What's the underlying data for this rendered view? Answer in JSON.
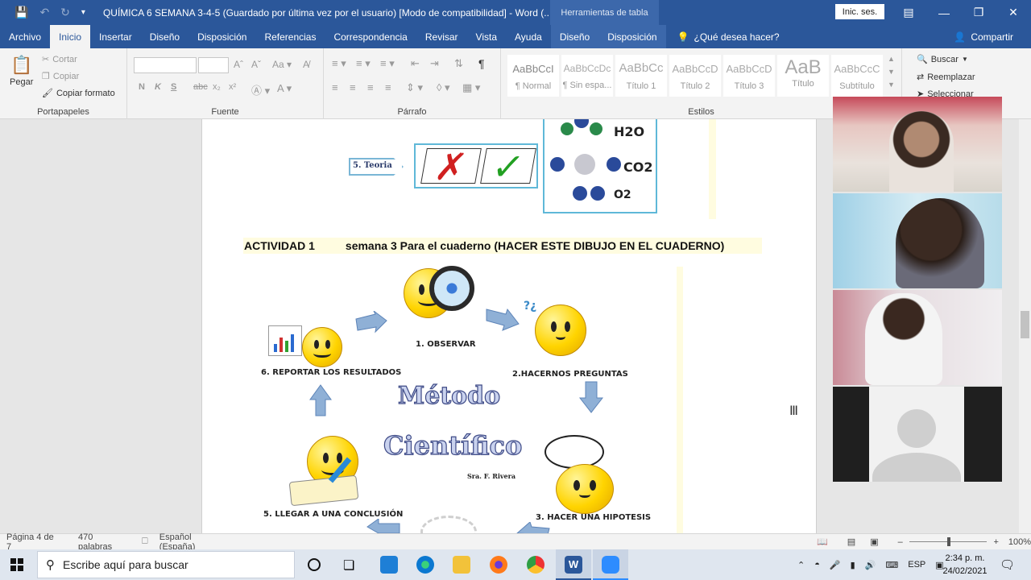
{
  "titlebar": {
    "document_title": "QUÍMICA 6 SEMANA 3-4-5 (Guardado por última vez por el usuario) [Modo de compatibilidad]  -  Word (...",
    "context_title": "Herramientas de tabla",
    "signin_label": "Inic. ses.",
    "save_icon": "save-icon",
    "undo_icon": "undo-icon",
    "redo_icon": "redo-icon"
  },
  "tabs": [
    {
      "label": "Archivo"
    },
    {
      "label": "Inicio",
      "active": true
    },
    {
      "label": "Insertar"
    },
    {
      "label": "Diseño"
    },
    {
      "label": "Disposición"
    },
    {
      "label": "Referencias"
    },
    {
      "label": "Correspondencia"
    },
    {
      "label": "Revisar"
    },
    {
      "label": "Vista"
    },
    {
      "label": "Ayuda"
    },
    {
      "label": "Diseño"
    },
    {
      "label": "Disposición"
    }
  ],
  "tell_me": "¿Qué desea hacer?",
  "share_label": "Compartir",
  "ribbon": {
    "clipboard": {
      "label": "Portapapeles",
      "paste": "Pegar",
      "cut": "Cortar",
      "copy": "Copiar",
      "format_painter": "Copiar formato"
    },
    "font": {
      "label": "Fuente",
      "bold": "N",
      "italic": "K",
      "underline": "S",
      "strike": "abc",
      "sub": "x₂",
      "sup": "x²"
    },
    "paragraph": {
      "label": "Párrafo"
    },
    "styles": {
      "label": "Estilos",
      "items": [
        {
          "preview": "AaBbCcI",
          "name": "¶ Normal"
        },
        {
          "preview": "AaBbCcDc",
          "name": "¶ Sin espa..."
        },
        {
          "preview": "AaBbCc",
          "name": "Título 1"
        },
        {
          "preview": "AaBbCcD",
          "name": "Título 2"
        },
        {
          "preview": "AaBbCcD",
          "name": "Título 3"
        },
        {
          "preview": "AaB",
          "name": "Título"
        },
        {
          "preview": "AaBbCcC",
          "name": "Subtítulo"
        }
      ]
    },
    "editing": {
      "find": "Buscar",
      "replace": "Reemplazar",
      "select": "Seleccionar"
    }
  },
  "document": {
    "teoria_label": "5.  Teoria",
    "h2o": "H2O",
    "co2": "CO2",
    "o2": "O2",
    "activity_number": "ACTIVIDAD 1",
    "activity_text": "semana 3 Para el cuaderno (HACER ESTE DIBUJO EN EL CUADERNO)",
    "diagram": {
      "title_line1": "Método",
      "title_line2": "Científico",
      "author": "Sra. F. Rivera",
      "steps": [
        "1. OBSERVAR",
        "2.HACERNOS PREGUNTAS",
        "3. HACER UNA HIPOTESIS",
        "5. LLEGAR A UNA CONCLUSIÓN",
        "6. REPORTAR LOS RESULTADOS"
      ]
    }
  },
  "statusbar": {
    "page": "Página 4 de 7",
    "words": "470 palabras",
    "language": "Español (España)",
    "zoom": "100%"
  },
  "taskbar": {
    "search_placeholder": "Escribe aquí para buscar",
    "language": "ESP",
    "time": "2:34 p. m.",
    "date": "24/02/2021"
  }
}
